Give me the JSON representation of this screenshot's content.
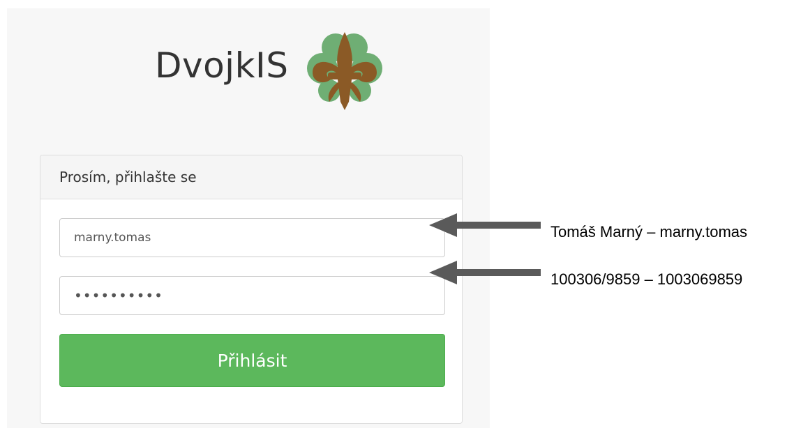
{
  "app": {
    "name": "DvojkIS",
    "logo_icon": "fleur-de-lis-logo-icon"
  },
  "login_panel": {
    "heading": "Prosím, přihlašte se",
    "username_value": "marny.tomas",
    "password_value": "••••••••••",
    "submit_label": "Přihlásit"
  },
  "annotations": [
    {
      "text": "Tomáš Marný – marny.tomas",
      "arrow_icon": "left-arrow-icon"
    },
    {
      "text": "100306/9859 –  1003069859",
      "arrow_icon": "left-arrow-icon"
    }
  ],
  "colors": {
    "button": "#5cb85c",
    "logo_brown": "#8b5a26",
    "logo_green": "#6fae74",
    "arrow": "#5a5a5a"
  }
}
